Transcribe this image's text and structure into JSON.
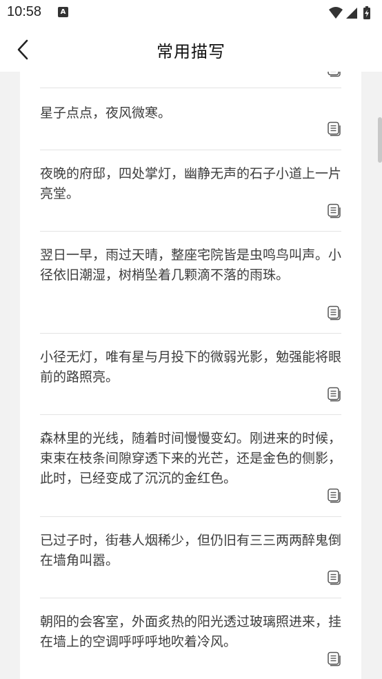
{
  "status_bar": {
    "time": "10:58",
    "notification_icon": "text-a-icon",
    "right_icons": [
      "wifi-icon",
      "signal-icon",
      "battery-charging-icon"
    ]
  },
  "header": {
    "title": "常用描写",
    "back_icon": "chevron-left-icon"
  },
  "list": {
    "items": [
      {
        "text": "",
        "icon": "copy-text-icon"
      },
      {
        "text": "星子点点，夜风微寒。",
        "icon": "copy-text-icon"
      },
      {
        "text": "夜晚的府邸，四处掌灯，幽静无声的石子小道上一片亮堂。",
        "icon": "copy-text-icon"
      },
      {
        "text": "翌日一早，雨过天晴，整座宅院皆是虫鸣鸟叫声。小径依旧潮湿，树梢坠着几颗滴不落的雨珠。",
        "icon": "copy-text-icon"
      },
      {
        "text": "小径无灯，唯有星与月投下的微弱光影，勉强能将眼前的路照亮。",
        "icon": "copy-text-icon"
      },
      {
        "text": "森林里的光线，随着时间慢慢变幻。刚进来的时候，束束在枝条间隙穿透下来的光芒，还是金色的侧影，此时，已经变成了沉沉的金红色。",
        "icon": "copy-text-icon"
      },
      {
        "text": "已过子时，街巷人烟稀少，但仍旧有三三两两醉鬼倒在墙角叫嚣。",
        "icon": "copy-text-icon"
      },
      {
        "text": "朝阳的会客室，外面炙热的阳光透过玻璃照进来，挂在墙上的空调呼呼呼地吹着冷风。",
        "icon": "copy-text-icon"
      }
    ]
  }
}
